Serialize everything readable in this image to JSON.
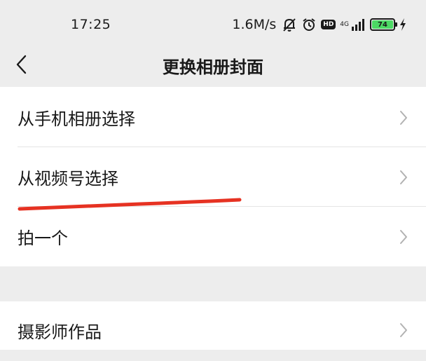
{
  "status_bar": {
    "time": "17:25",
    "net_speed": "1.6M/s",
    "hd_label": "HD",
    "network_type": "4G",
    "battery_level": "74",
    "icons": [
      "mute-bell-icon",
      "alarm-icon",
      "hd-icon",
      "signal-icon",
      "battery-icon",
      "charging-icon"
    ]
  },
  "nav": {
    "title": "更换相册封面",
    "back_icon": "chevron-left-icon"
  },
  "options": [
    {
      "label": "从手机相册选择"
    },
    {
      "label": "从视频号选择"
    },
    {
      "label": "拍一个"
    }
  ],
  "secondary_options": [
    {
      "label": "摄影师作品"
    }
  ],
  "annotation": {
    "color": "#e63222"
  },
  "colors": {
    "background": "#ededed",
    "card": "#ffffff",
    "text": "#191919",
    "chevron": "#b2b2b2"
  }
}
